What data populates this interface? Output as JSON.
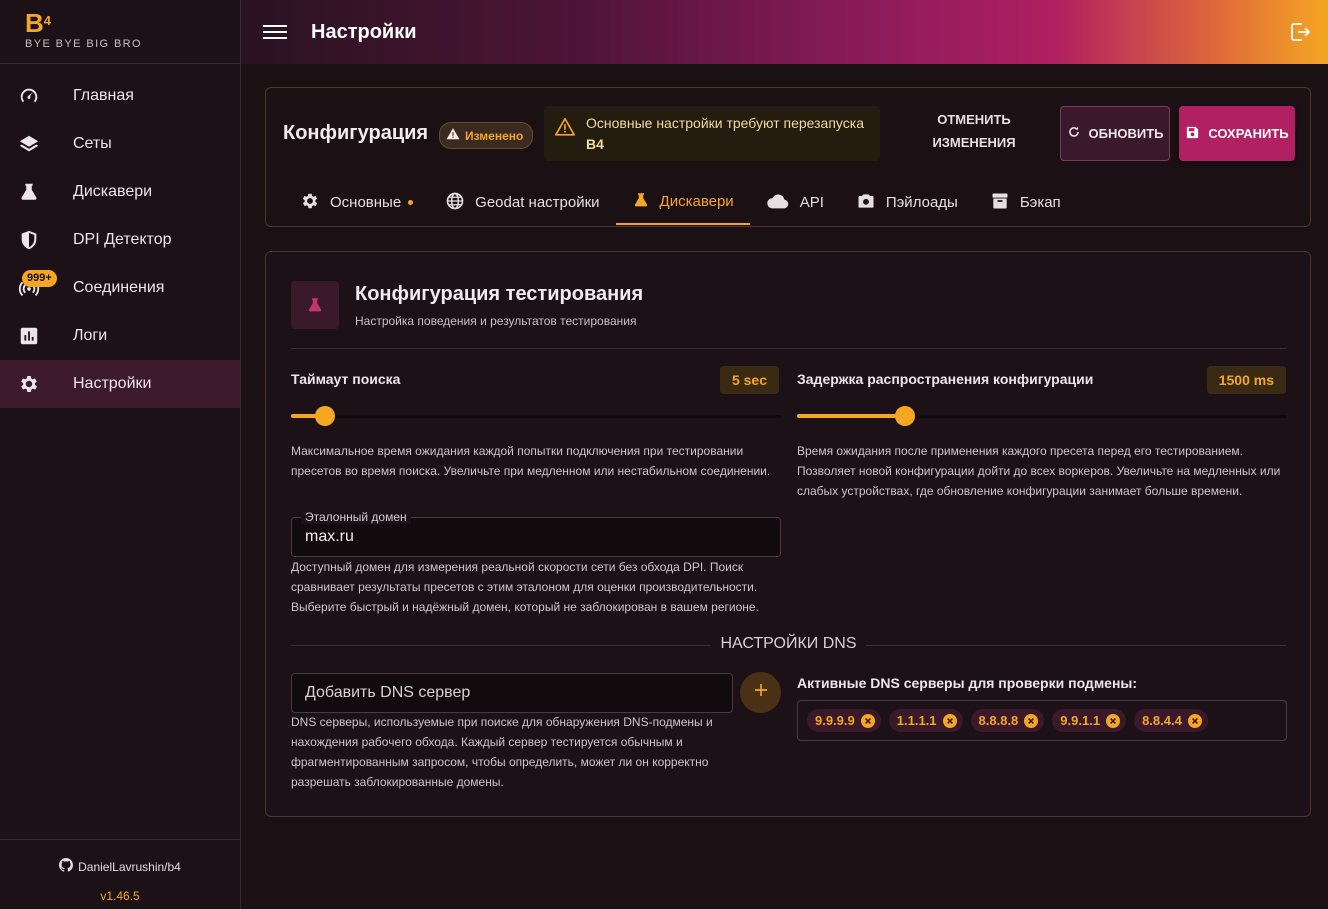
{
  "brand": {
    "logo": "B",
    "logo_sup": "4",
    "subtitle": "BYE BYE BIG BRO"
  },
  "nav": [
    {
      "label": "Главная",
      "icon": "gauge-icon"
    },
    {
      "label": "Сеты",
      "icon": "layers-icon"
    },
    {
      "label": "Дискавери",
      "icon": "flask-icon"
    },
    {
      "label": "DPI Детектор",
      "icon": "shield-icon"
    },
    {
      "label": "Соединения",
      "icon": "wifi-icon",
      "badge": "999+"
    },
    {
      "label": "Логи",
      "icon": "chart-icon"
    },
    {
      "label": "Настройки",
      "icon": "gear-icon",
      "active": true
    }
  ],
  "footer": {
    "repo": "DanielLavrushin/b4",
    "version": "v1.46.5"
  },
  "header": {
    "title": "Настройки"
  },
  "config": {
    "title": "Конфигурация",
    "changed_badge": "Изменено",
    "warning_line1": "Основные настройки требуют перезапуска",
    "warning_line2": "B4",
    "cancel_line1": "ОТМЕНИТЬ",
    "cancel_line2": "ИЗМЕНЕНИЯ",
    "refresh": "ОБНОВИТЬ",
    "save": "СОХРАНИТЬ"
  },
  "tabs": [
    {
      "label": "Основные",
      "icon": "gear-icon",
      "dot": true
    },
    {
      "label": "Geodat настройки",
      "icon": "globe-icon"
    },
    {
      "label": "Дискавери",
      "icon": "flask-icon",
      "active": true
    },
    {
      "label": "API",
      "icon": "cloud-icon"
    },
    {
      "label": "Пэйлоады",
      "icon": "camera-icon"
    },
    {
      "label": "Бэкап",
      "icon": "archive-icon"
    }
  ],
  "testing": {
    "title": "Конфигурация тестирования",
    "subtitle": "Настройка поведения и результатов тестирования",
    "timeout": {
      "label": "Таймаут поиска",
      "value": "5 sec",
      "level": 0.07,
      "help": "Максимальное время ожидания каждой попытки подключения при тестировании пресетов во время поиска. Увеличьте при медленном или нестабильном соединении."
    },
    "delay": {
      "label": "Задержка распространения конфигурации",
      "value": "1500 ms",
      "level": 0.22,
      "help": "Время ожидания после применения каждого пресета перед его тестированием. Позволяет новой конфигурации дойти до всех воркеров. Увеличьте на медленных или слабых устройствах, где обновление конфигурации занимает больше времени."
    },
    "ref_domain": {
      "label": "Эталонный домен",
      "value": "max.ru",
      "help": "Доступный домен для измерения реальной скорости сети без обхода DPI. Поиск сравнивает результаты пресетов с этим эталоном для оценки производительности. Выберите быстрый и надёжный домен, который не заблокирован в вашем регионе."
    }
  },
  "dns": {
    "section_title": "НАСТРОЙКИ DNS",
    "placeholder": "Добавить DNS сервер",
    "help": "DNS серверы, используемые при поиске для обнаружения DNS-подмены и нахождения рабочего обхода. Каждый сервер тестируется обычным и фрагментированным запросом, чтобы определить, может ли он корректно разрешать заблокированные домены.",
    "active_label": "Активные DNS серверы для проверки подмены:",
    "servers": [
      "9.9.9.9",
      "1.1.1.1",
      "8.8.8.8",
      "9.9.1.1",
      "8.8.4.4"
    ]
  },
  "colors": {
    "accent": "#f5a623",
    "primary": "#b02063"
  }
}
